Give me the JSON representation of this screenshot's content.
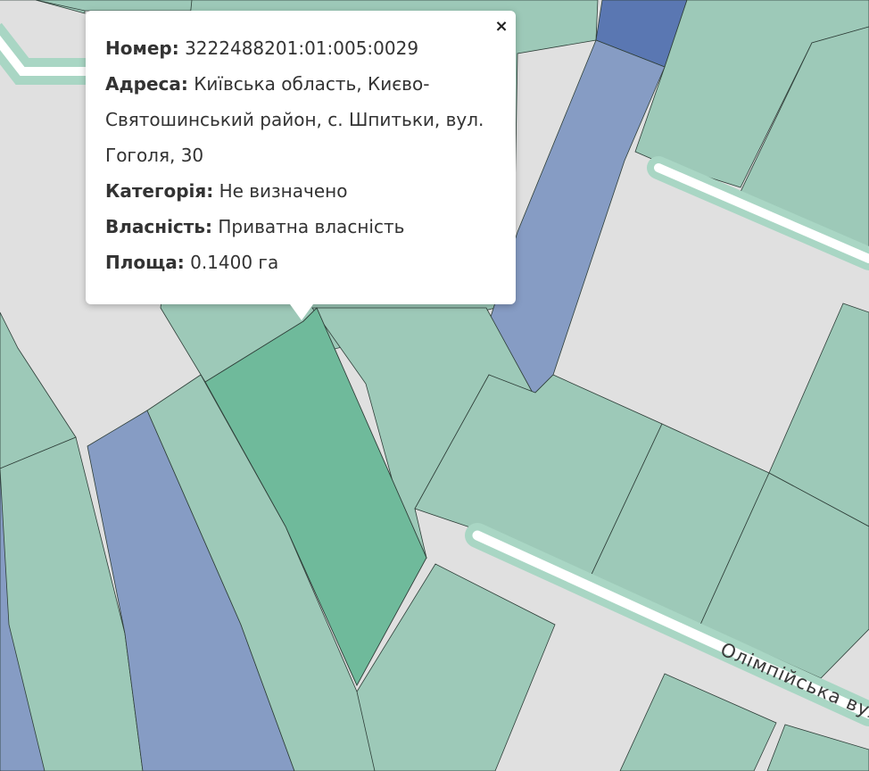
{
  "map": {
    "colors": {
      "background": "#e0e0e0",
      "parcel_private": "#9dc9b8",
      "parcel_selected": "#6fba9b",
      "parcel_communal": "#869cc4",
      "parcel_state": "#5a77b2",
      "road_fill": "#ffffff",
      "road_casing": "#a9d6c4",
      "parcel_outline": "#2e3e38"
    },
    "street_label": "Олімпійська вул"
  },
  "popup": {
    "close_icon": "close-icon",
    "close_symbol": "×",
    "fields": [
      {
        "label": "Номер:",
        "value": "3222488201:01:005:0029"
      },
      {
        "label": "Адреса:",
        "value": "Київська область, Києво-Святошинський район, с. Шпитьки, вул. Гоголя, 30"
      },
      {
        "label": "Категорія:",
        "value": "Не визначено"
      },
      {
        "label": "Власність:",
        "value": "Приватна власність"
      },
      {
        "label": "Площа:",
        "value": "0.1400 га"
      }
    ]
  }
}
